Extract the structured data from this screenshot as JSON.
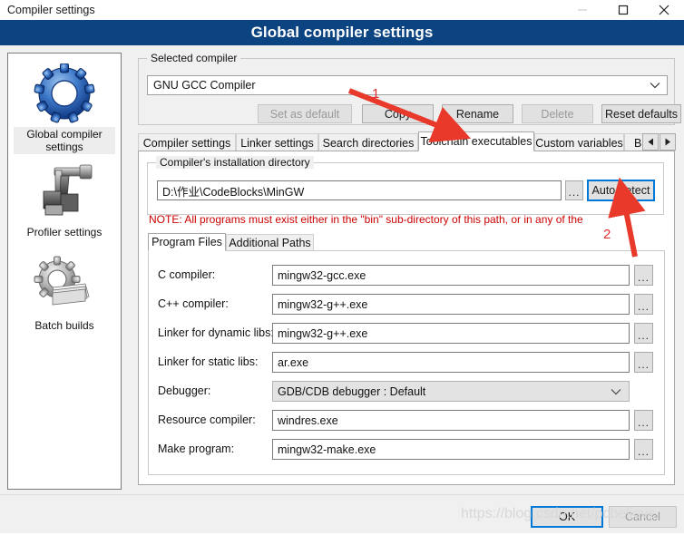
{
  "window": {
    "title": "Compiler settings",
    "controls": [
      {
        "name": "minimize",
        "glyph": "minimize-icon"
      },
      {
        "name": "maximize",
        "glyph": "maximize-icon"
      },
      {
        "name": "close",
        "glyph": "close-icon"
      }
    ]
  },
  "header": {
    "title": "Global compiler settings",
    "background": "#0b4480",
    "color": "#ffffff"
  },
  "sidebar": {
    "items": [
      {
        "label": "Global compiler settings",
        "icon": "blue-gear-icon",
        "selected": true
      },
      {
        "label": "Profiler settings",
        "icon": "profiler-tool-icon",
        "selected": false
      },
      {
        "label": "Batch builds",
        "icon": "gray-gear-pages-icon",
        "selected": false
      }
    ]
  },
  "selected_compiler": {
    "group_title": "Selected compiler",
    "value": "GNU GCC Compiler",
    "dropdown_icon": "chevron-down-icon",
    "buttons": [
      {
        "label": "Set as default",
        "enabled": false
      },
      {
        "label": "Copy",
        "enabled": true
      },
      {
        "label": "Rename",
        "enabled": true
      },
      {
        "label": "Delete",
        "enabled": false
      },
      {
        "label": "Reset defaults",
        "enabled": true
      }
    ]
  },
  "tabs": {
    "items": [
      {
        "label": "Compiler settings",
        "active": false
      },
      {
        "label": "Linker settings",
        "active": false
      },
      {
        "label": "Search directories",
        "active": false
      },
      {
        "label": "Toolchain executables",
        "active": true
      },
      {
        "label": "Custom variables",
        "active": false
      },
      {
        "label": "Bui",
        "active": false
      }
    ],
    "scroll_left_icon": "triangle-left-icon",
    "scroll_right_icon": "triangle-right-icon"
  },
  "install_dir": {
    "group_title": "Compiler's installation directory",
    "path": "D:\\作业\\CodeBlocks\\MinGW",
    "browse_label": "...",
    "autodetect_label": "Auto-detect",
    "autodetect_focused": true,
    "note": "NOTE: All programs must exist either in the \"bin\" sub-directory of this path, or in any of the",
    "note_color": "#cc0000"
  },
  "inner_tabs": {
    "items": [
      {
        "label": "Program Files",
        "active": true
      },
      {
        "label": "Additional Paths",
        "active": false
      }
    ]
  },
  "program_files": {
    "rows": [
      {
        "label": "C compiler:",
        "value": "mingw32-gcc.exe",
        "type": "text",
        "browse": "..."
      },
      {
        "label": "C++ compiler:",
        "value": "mingw32-g++.exe",
        "type": "text",
        "browse": "..."
      },
      {
        "label": "Linker for dynamic libs:",
        "value": "mingw32-g++.exe",
        "type": "text",
        "browse": "..."
      },
      {
        "label": "Linker for static libs:",
        "value": "ar.exe",
        "type": "text",
        "browse": "..."
      },
      {
        "label": "Debugger:",
        "value": "GDB/CDB debugger : Default",
        "type": "combo-disabled",
        "browse": ""
      },
      {
        "label": "Resource compiler:",
        "value": "windres.exe",
        "type": "text",
        "browse": "..."
      },
      {
        "label": "Make program:",
        "value": "mingw32-make.exe",
        "type": "text",
        "browse": "..."
      }
    ]
  },
  "footer": {
    "ok_label": "OK",
    "cancel_label": "Cancel",
    "ok_focused": true
  },
  "annotations": {
    "arrow1_number": "1",
    "arrow2_number": "2",
    "arrow_color": "#e8392b"
  },
  "watermark": {
    "text": "https://blog.csdn.net/pcbelieve"
  }
}
